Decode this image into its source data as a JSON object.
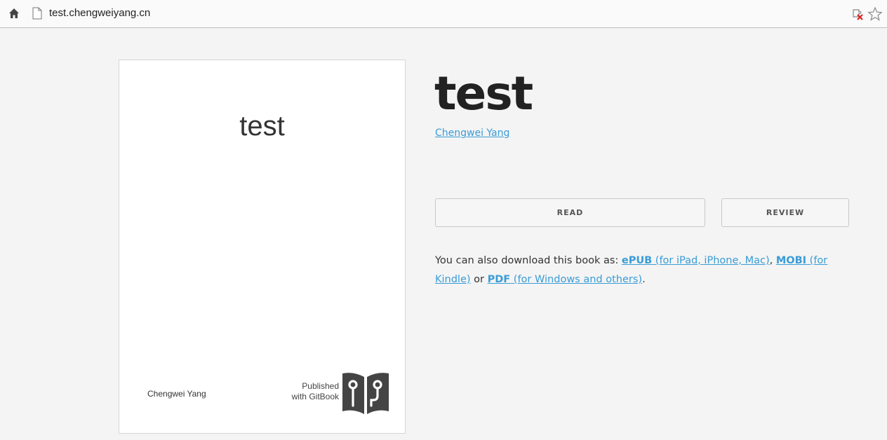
{
  "browser": {
    "url": "test.chengweiyang.cn",
    "icons": [
      "home-icon",
      "page-icon",
      "extension-blocked-icon",
      "bookmark-star-icon"
    ]
  },
  "cover": {
    "title": "test",
    "author": "Chengwei Yang",
    "published_line1": "Published",
    "published_line2": "with GitBook"
  },
  "book": {
    "title": "test",
    "author": "Chengwei Yang"
  },
  "actions": {
    "read_label": "READ",
    "review_label": "REVIEW"
  },
  "download": {
    "intro": "You can also download this book as: ",
    "epub_label": "ePUB",
    "epub_note": " (for iPad, iPhone, Mac)",
    "sep1": ", ",
    "mobi_label": "MOBI",
    "mobi_note": " (for Kindle)",
    "sep2": " or ",
    "pdf_label": "PDF",
    "pdf_note": " (for Windows and others)",
    "end": "."
  },
  "colors": {
    "link": "#3a9cd7",
    "background": "#f4f4f4"
  }
}
